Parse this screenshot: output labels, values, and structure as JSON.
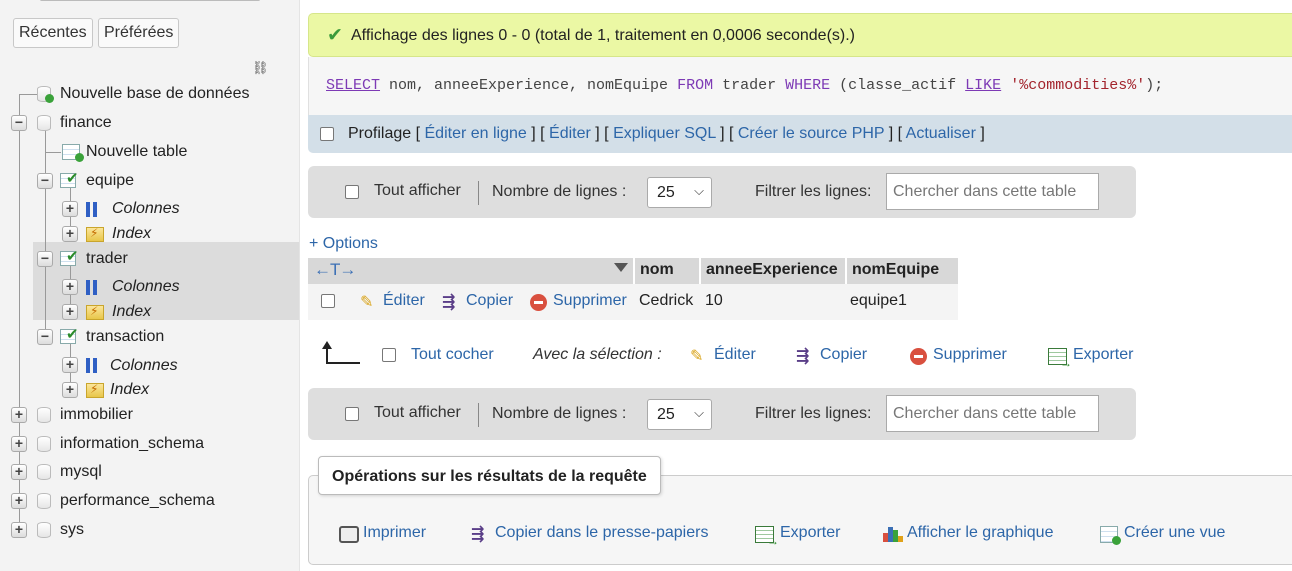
{
  "sidebar": {
    "tabs": [
      "Récentes",
      "Préférées"
    ],
    "tree": {
      "new_database": "Nouvelle base de données",
      "finance": "finance",
      "new_table": "Nouvelle table",
      "equipe": "equipe",
      "columns": "Colonnes",
      "index": "Index",
      "trader": "trader",
      "transaction": "transaction",
      "immobilier": "immobilier",
      "information_schema": "information_schema",
      "mysql": "mysql",
      "performance_schema": "performance_schema",
      "sys": "sys"
    }
  },
  "main": {
    "success_message": "Affichage des lignes 0 - 0 (total de 1, traitement en 0,0006 seconde(s).)",
    "sql": {
      "select": "SELECT",
      "fields": " nom, anneeExperience, nomEquipe ",
      "from": "FROM",
      "table": " trader ",
      "where": "WHERE",
      "cond_open": " (classe_actif ",
      "like": "LIKE",
      "value": "'%commodities%'",
      "cond_close": ");"
    },
    "profiling": {
      "label": "Profilage",
      "links": [
        "Éditer en ligne",
        "Éditer",
        "Expliquer SQL",
        "Créer le source PHP",
        "Actualiser"
      ]
    },
    "nav": {
      "show_all": "Tout afficher",
      "rows_label": "Nombre de lignes :",
      "rows_value": "25",
      "filter_label": "Filtrer les lignes:",
      "search_placeholder": "Chercher dans cette table"
    },
    "options_link": "+ Options",
    "table": {
      "columns": [
        "nom",
        "anneeExperience",
        "nomEquipe"
      ],
      "rows": [
        {
          "nom": "Cedrick",
          "anneeExperience": "10",
          "nomEquipe": "equipe1"
        }
      ],
      "row_actions": {
        "edit": "Éditer",
        "copy": "Copier",
        "delete": "Supprimer"
      }
    },
    "selection": {
      "check_all": "Tout cocher",
      "with_selection": "Avec la sélection :",
      "edit": "Éditer",
      "copy": "Copier",
      "delete": "Supprimer",
      "export": "Exporter"
    },
    "operations": {
      "legend": "Opérations sur les résultats de la requête",
      "print": "Imprimer",
      "copy_clipboard": "Copier dans le presse-papiers",
      "export": "Exporter",
      "chart": "Afficher le graphique",
      "create_view": "Créer une vue"
    }
  }
}
